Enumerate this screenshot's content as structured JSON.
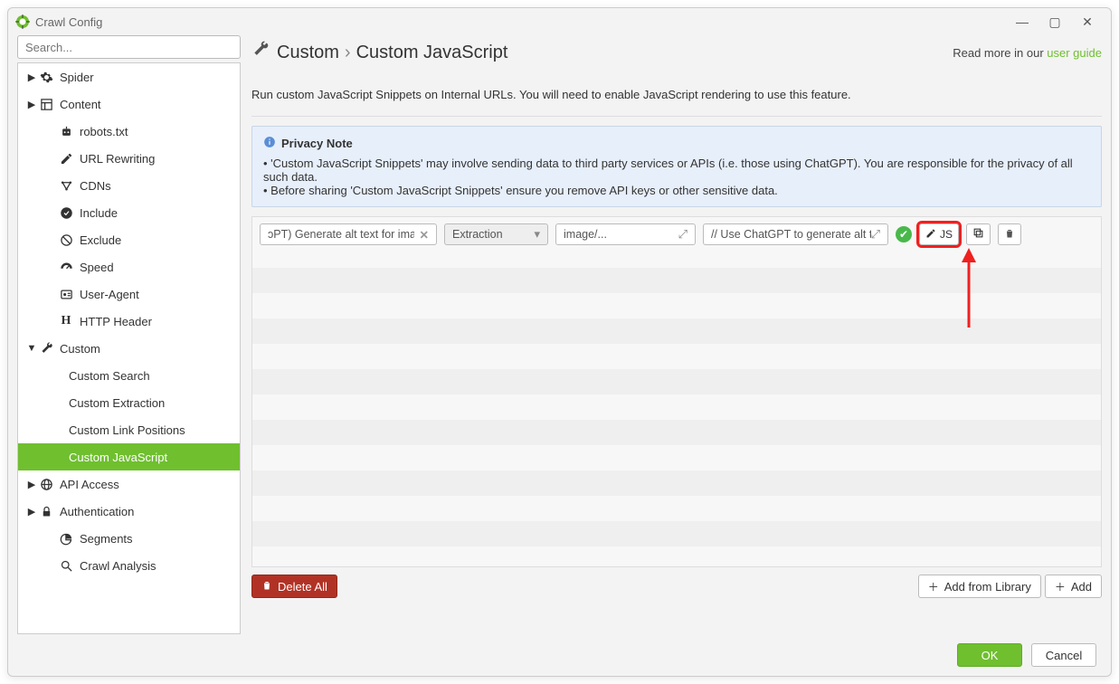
{
  "window": {
    "title": "Crawl Config",
    "minimize": "—",
    "maximize": "▢",
    "close": "✕"
  },
  "sidebar": {
    "search_placeholder": "Search...",
    "items": [
      {
        "label": "Spider",
        "caret": "▶",
        "icon": "gear"
      },
      {
        "label": "Content",
        "caret": "▶",
        "icon": "layout"
      },
      {
        "label": "robots.txt",
        "caret": "",
        "icon": "robot",
        "child": true
      },
      {
        "label": "URL Rewriting",
        "caret": "",
        "icon": "edit",
        "child": true
      },
      {
        "label": "CDNs",
        "caret": "",
        "icon": "cdn",
        "child": true
      },
      {
        "label": "Include",
        "caret": "",
        "icon": "check",
        "child": true
      },
      {
        "label": "Exclude",
        "caret": "",
        "icon": "ban",
        "child": true
      },
      {
        "label": "Speed",
        "caret": "",
        "icon": "gauge",
        "child": true
      },
      {
        "label": "User-Agent",
        "caret": "",
        "icon": "ua",
        "child": true
      },
      {
        "label": "HTTP Header",
        "caret": "",
        "icon": "H",
        "child": true
      },
      {
        "label": "Custom",
        "caret": "▼",
        "icon": "wrench"
      },
      {
        "label": "Custom Search",
        "caret": "",
        "icon": "",
        "child2": true
      },
      {
        "label": "Custom Extraction",
        "caret": "",
        "icon": "",
        "child2": true
      },
      {
        "label": "Custom Link Positions",
        "caret": "",
        "icon": "",
        "child2": true
      },
      {
        "label": "Custom JavaScript",
        "caret": "",
        "icon": "",
        "child2": true,
        "active": true
      },
      {
        "label": "API Access",
        "caret": "▶",
        "icon": "globe"
      },
      {
        "label": "Authentication",
        "caret": "▶",
        "icon": "lock"
      },
      {
        "label": "Segments",
        "caret": "",
        "icon": "pie",
        "child": true
      },
      {
        "label": "Crawl Analysis",
        "caret": "",
        "icon": "search",
        "child": true
      }
    ]
  },
  "main": {
    "breadcrumb_parent": "Custom",
    "breadcrumb_sep": "›",
    "breadcrumb_current": "Custom JavaScript",
    "readmore_prefix": "Read more in our ",
    "readmore_link": "user guide",
    "description": "Run custom JavaScript Snippets on Internal URLs. You will need to enable JavaScript rendering to use this feature.",
    "note_heading": "Privacy Note",
    "note_line1": "• 'Custom JavaScript Snippets' may involve sending data to third party services or APIs (i.e. those using ChatGPT). You are responsible for the privacy of all such data.",
    "note_line2": "• Before sharing 'Custom JavaScript Snippets' ensure you remove API keys or other sensitive data.",
    "row": {
      "name_value": "ɔPT) Generate alt text for images",
      "type_value": "Extraction",
      "filter_value": "image/...",
      "code_value": "// Use ChatGPT to generate alt tex",
      "js_button": "JS"
    },
    "buttons": {
      "delete_all": "Delete All",
      "add_library": "Add from Library",
      "add": "Add"
    }
  },
  "footer": {
    "ok": "OK",
    "cancel": "Cancel"
  }
}
